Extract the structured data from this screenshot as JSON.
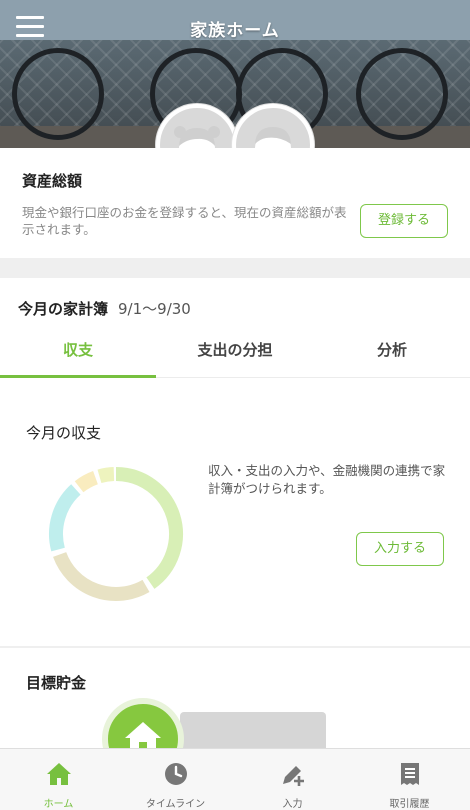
{
  "header": {
    "title": "家族ホーム",
    "menu_icon": "hamburger-menu-icon",
    "avatars": [
      "female-avatar-icon",
      "male-avatar-icon"
    ]
  },
  "assets": {
    "title": "資産総額",
    "description": "現金や銀行口座のお金を登録すると、現在の資産総額が表示されます。",
    "register_button": "登録する"
  },
  "budget": {
    "title": "今月の家計簿",
    "range": "9/1〜9/30",
    "tabs": [
      {
        "label": "収支",
        "active": true
      },
      {
        "label": "支出の分担",
        "active": false
      },
      {
        "label": "分析",
        "active": false
      }
    ],
    "section_title": "今月の収支",
    "note": "収入・支出の入力や、金融機関の連携で家計簿がつけられます。",
    "input_button": "入力する",
    "donut_colors": [
      "#d8efb6",
      "#e8e2c4",
      "#bfeeed",
      "#f9ecbf",
      "#eef3be"
    ]
  },
  "goal": {
    "title": "目標貯金",
    "icon": "house-icon"
  },
  "bottom_nav": {
    "items": [
      {
        "label": "ホーム",
        "icon": "home-icon",
        "active": true
      },
      {
        "label": "タイムライン",
        "icon": "clock-icon",
        "active": false
      },
      {
        "label": "入力",
        "icon": "pen-plus-icon",
        "active": false
      },
      {
        "label": "取引履歴",
        "icon": "receipt-icon",
        "active": false
      }
    ]
  },
  "colors": {
    "accent": "#77c03f",
    "accent_button_text": "#6cba36"
  }
}
